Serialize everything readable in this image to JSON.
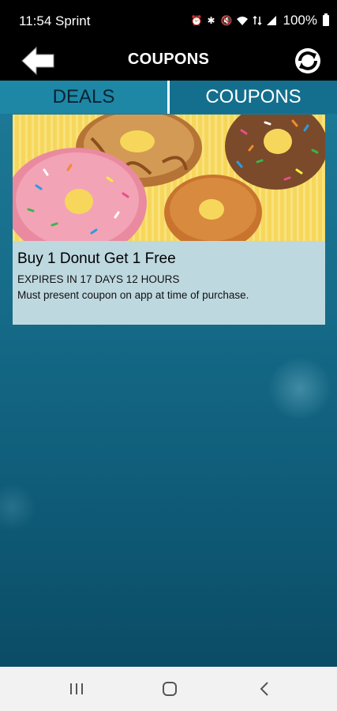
{
  "status_bar": {
    "time": "11:54",
    "carrier": "Sprint",
    "battery": "100%",
    "icons": [
      "alarm-icon",
      "bluetooth-icon",
      "mute-icon",
      "wifi-icon",
      "data-icon",
      "signal-icon",
      "battery-icon"
    ]
  },
  "app_bar": {
    "title": "COUPONS"
  },
  "tabs": [
    {
      "label": "DEALS",
      "active": false
    },
    {
      "label": "COUPONS",
      "active": true
    }
  ],
  "coupon": {
    "title": "Buy 1 Donut Get 1 Free",
    "expiry": "EXPIRES IN 17 DAYS 12 HOURS",
    "description": "Must present coupon on app at time of purchase."
  },
  "colors": {
    "header_bg": "#000000",
    "content_top": "#1d7a98",
    "content_bottom": "#0b4c66",
    "card_bg": "#bed8e0",
    "image_bg": "#f6d75b"
  }
}
